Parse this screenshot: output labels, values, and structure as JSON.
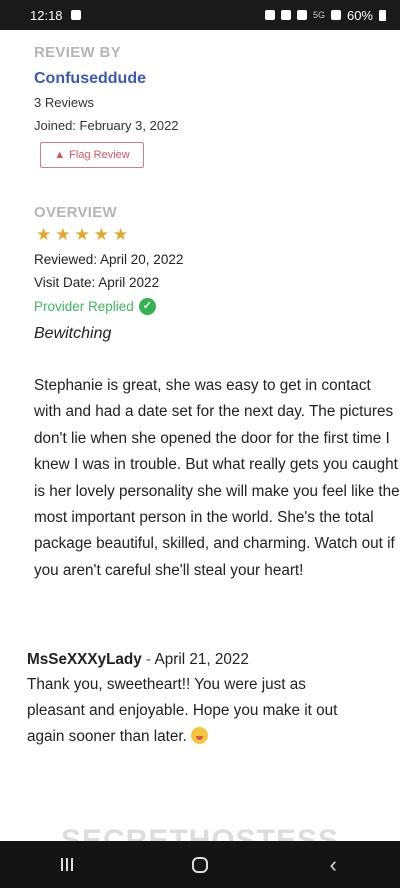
{
  "status_bar": {
    "time": "12:18",
    "network": "5G",
    "battery": "60%"
  },
  "reviewer_section": {
    "label": "REVIEW BY",
    "reviewer_name": "Confuseddude",
    "reviews_count": "3 Reviews",
    "joined": "Joined: February 3, 2022",
    "flag_button": "Flag Review"
  },
  "overview": {
    "label": "OVERVIEW",
    "stars": "★★★★★",
    "rating": 5,
    "reviewed": "Reviewed: April 20, 2022",
    "visit_date": "Visit Date: April 2022",
    "provider_replied": "Provider Replied",
    "title": "Bewitching",
    "body": "Stephanie is great, she was easy to get in contact with and had a date set for the next day. The pictures don't lie when she opened the door for the first time I knew I was in trouble. But what really gets you caught is her lovely personality she will make you feel like the most important person in the world. She's the total package beautiful, skilled, and charming. Watch out if you aren't careful she'll steal your heart!"
  },
  "reply": {
    "author": "MsSeXXXyLady",
    "separator": " - ",
    "date": "April 21, 2022",
    "body": "Thank you, sweetheart!! You were just as pleasant and enjoyable. Hope you make it out again sooner than later. "
  },
  "watermark": "SECRETHOSTESS",
  "icons": {
    "flag": "warning-triangle-icon",
    "verified": "check-circle-icon",
    "emoji": "tongue-face-emoji-icon"
  },
  "colors": {
    "reviewer_link": "#3b59b8",
    "star": "#e4a829",
    "replied_green": "#3dbb5a",
    "flag_red": "#d9545f"
  }
}
